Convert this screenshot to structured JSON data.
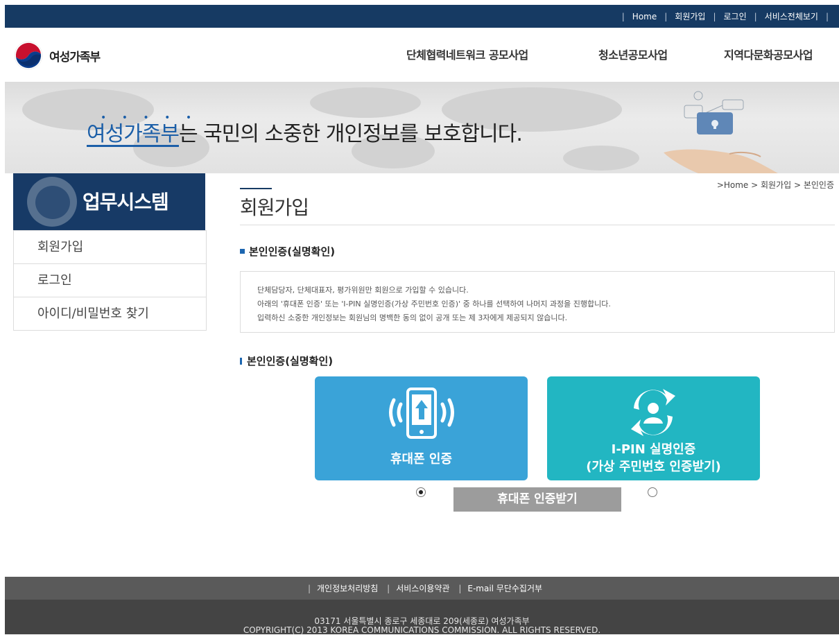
{
  "topnav": {
    "links": [
      "Home",
      "회원가입",
      "로그인",
      "서비스전체보기"
    ]
  },
  "header": {
    "logo_text": "여성가족부",
    "gnb": [
      "단체협력네트워크 공모사업",
      "청소년공모사업",
      "지역다문화공모사업"
    ]
  },
  "banner": {
    "highlight": "여성가족부",
    "text": "는 국민의 소중한 개인정보를 보호합니다."
  },
  "sidebar": {
    "title": "업무시스템",
    "items": [
      "회원가입",
      "로그인",
      "아이디/비밀번호 찾기"
    ]
  },
  "breadcrumb": ">Home > 회원가입 > 본인인증",
  "main": {
    "page_title": "회원가입",
    "section_title": "본인인증(실명확인)",
    "info_lines": [
      "단체담당자, 단체대표자, 평가위원만 회원으로 가입할 수 있습니다.",
      "아래의 '휴대폰 인증' 또는 'I-PIN 실명인증(가상 주민번호 인증)' 중 하나를 선택하여 나머지 과정을 진행합니다.",
      "입력하신 소중한 개인정보는 회원님의 명백한 동의 없이 공개 또는 제 3자에게 제공되지 않습니다."
    ],
    "section_title2": "본인인증(실명확인)",
    "phone_card_label": "휴대폰 인증",
    "ipin_card_line1": "I-PIN 실명인증",
    "ipin_card_line2": "(가상 주민번호 인증받기)",
    "cert_button": "휴대폰 인증받기",
    "selected_option": "휴대폰 인증"
  },
  "footer": {
    "links": [
      "개인정보처리방침",
      "서비스이용약관",
      "E-mail 무단수집거부"
    ],
    "address": "03171 서울특별시 종로구 세종대로 209(세종로) 여성가족부",
    "copyright": "COPYRIGHT(C) 2013 KOREA COMMUNICATIONS COMMISSION. ALL RIGHTS RESERVED."
  },
  "colors": {
    "navy": "#163a63",
    "phone_card": "#3aa3d8",
    "ipin_card": "#22b6c2",
    "accent_blue": "#1c5fa8"
  },
  "icons": [
    "gov-logo-icon",
    "phone-signal-icon",
    "user-refresh-icon",
    "radio-selected-icon",
    "radio-unselected-icon"
  ]
}
